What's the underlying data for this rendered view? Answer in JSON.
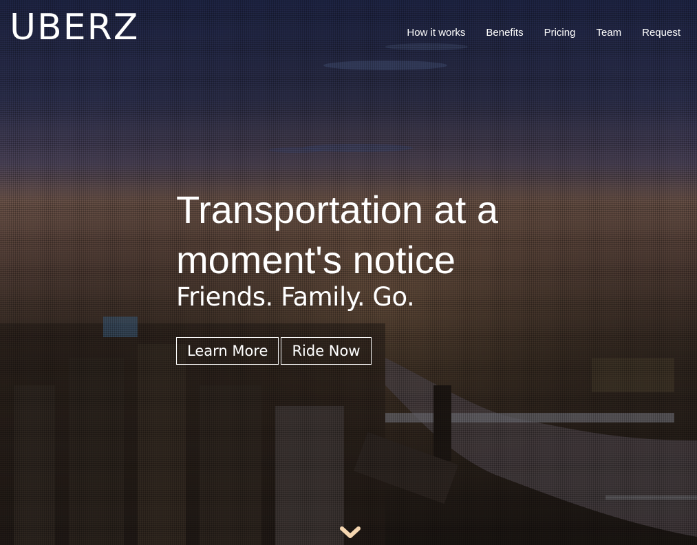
{
  "brand": {
    "logo": "UBERZ"
  },
  "nav": {
    "items": [
      {
        "label": "How it works"
      },
      {
        "label": "Benefits"
      },
      {
        "label": "Pricing"
      },
      {
        "label": "Team"
      },
      {
        "label": "Request"
      }
    ]
  },
  "hero": {
    "headline_line1": "Transportation at a",
    "headline_line2": "moment's notice",
    "tagline": "Friends. Family. Go.",
    "buttons": {
      "learn_more": "Learn More",
      "ride_now": "Ride Now"
    },
    "scroll_icon": "chevron-down-icon",
    "background_description_colors": {
      "sky_top": "#1f2540",
      "horizon": "#6b5044",
      "ground": "#1d1815",
      "chevron": "#f5d6b0"
    }
  }
}
